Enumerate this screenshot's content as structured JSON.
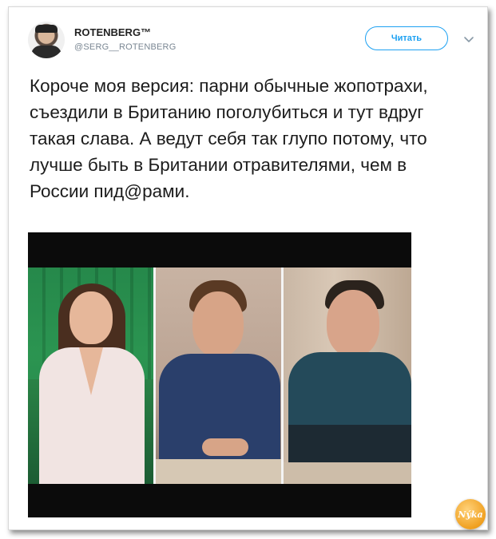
{
  "tweet": {
    "display_name": "ROTENBERG™",
    "handle": "@SERG__ROTENBERG",
    "follow_label": "Читать",
    "text": "Короче моя версия: парни обычные жопотрахи, съездили в Британию поголубиться и тут вдруг такая слава. А ведут себя так глупо потому, что лучше быть в Британии отравителями, чем в России пид@рами."
  },
  "icons": {
    "avatar": "avatar-photo",
    "menu": "chevron-down-icon",
    "watermark": "logo-badge"
  },
  "watermark": {
    "text": "Nýka"
  },
  "colors": {
    "accent": "#1da1f2",
    "text": "#1c1c1c",
    "muted": "#7a8793"
  }
}
